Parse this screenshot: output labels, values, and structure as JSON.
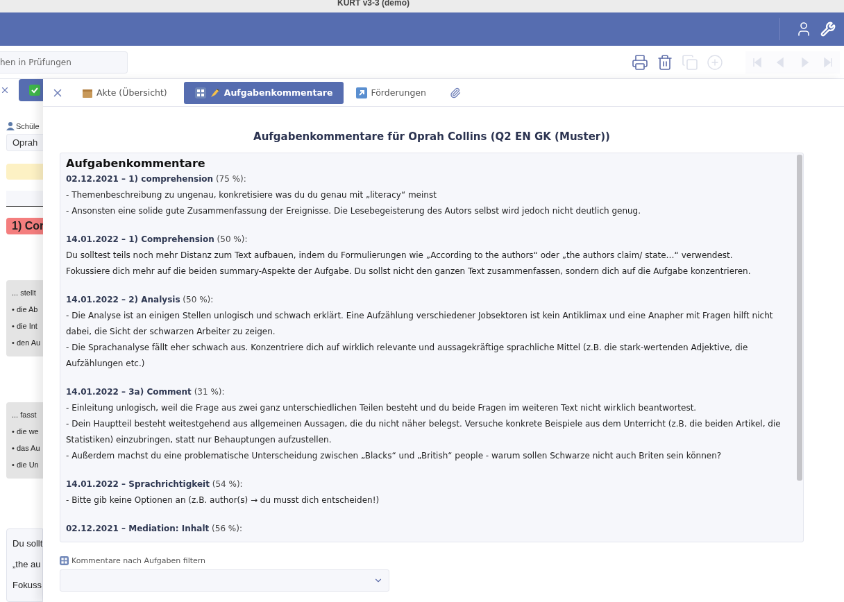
{
  "window": {
    "title": "KURT v3-3 (demo)"
  },
  "header": {
    "actions": [
      {
        "kind": "user"
      },
      {
        "kind": "settings"
      }
    ]
  },
  "toolbar": {
    "search": {
      "placeholder": "hen in Prüfungen"
    },
    "actions": [
      {
        "kind": "print",
        "disabled": false
      },
      {
        "kind": "delete",
        "disabled": false
      },
      {
        "kind": "copy",
        "disabled": true
      },
      {
        "kind": "add",
        "disabled": true
      }
    ],
    "navigation": [
      {
        "kind": "first",
        "disabled": true
      },
      {
        "kind": "previous",
        "disabled": true
      },
      {
        "kind": "next",
        "disabled": true
      },
      {
        "kind": "last",
        "disabled": true
      }
    ]
  },
  "background": {
    "tabs": [
      {
        "kind": "close",
        "selected": false
      },
      {
        "kind": "check",
        "selected": true
      }
    ],
    "student_label": "Schüle",
    "student_value": "Oprah",
    "heading": "1) Cor",
    "boxes": [
      {
        "kind": "grey",
        "lines": [
          "... stellt",
          "• die Ab",
          "• die Int",
          "• den Au"
        ]
      },
      {
        "kind": "grey",
        "lines": [
          "... fasst",
          "• die we",
          "• das Au",
          "• die Un"
        ]
      },
      {
        "kind": "light",
        "lines": [
          "Du sollt",
          "„the au",
          "Fokuss"
        ]
      }
    ]
  },
  "panel": {
    "tabs": [
      {
        "kind": "close",
        "selected": false
      },
      {
        "kind": "file",
        "label": "Akte (Übersicht)",
        "selected": false
      },
      {
        "kind": "comments",
        "label": "Aufgabenkommentare",
        "selected": true
      },
      {
        "kind": "support",
        "label": "Förderungen",
        "selected": false
      },
      {
        "kind": "attachment",
        "selected": false
      }
    ],
    "title": "Aufgabenkommentare für Oprah Collins (Q2 EN GK (Muster))",
    "comments": {
      "heading": "Aufgabenkommentare",
      "entries": [
        {
          "title": "**02.12.2021 – 1) comprehension** (75 %):",
          "lines": [
            "- Themenbeschreibung zu ungenau, konkretisiere was du du genau mit „literacy“ meinst",
            "- Ansonsten eine solide gute Zusammenfassung der Ereignisse. Die Lesebegeisterung des Autors selbst wird jedoch nicht deutlich genug."
          ]
        },
        {
          "title": "**14.01.2022 – 1) Comprehension** (50 %):",
          "lines": [
            "Du solltest teils noch mehr Distanz zum Text aufbauen, indem du Formulierungen wie „According to the authors“ oder „the authors claim/ state…“ verwendest.",
            "Fokussiere dich mehr auf die beiden summary-Aspekte der Aufgabe. Du sollst nicht den ganzen Text zusammenfassen, sondern dich auf die Aufgabe konzentrieren."
          ]
        },
        {
          "title": "**14.01.2022 – 2) Analysis** (50 %):",
          "lines": [
            "- Die Analyse ist an einigen Stellen unlogisch und schwach erklärt. Eine Aufzählung verschiedener Jobsektoren ist kein Antiklimax und eine Anapher mit Fragen hilft nicht dabei, die Sicht der schwarzen Arbeiter zu zeigen.",
            "- Die Sprachanalyse fällt eher schwach aus. Konzentriere dich auf wirklich relevante und aussagekräftige sprachliche Mittel (z.B. die stark-wertenden Adjektive, die Aufzählungen etc.)"
          ]
        },
        {
          "title": "**14.01.2022 – 3a) Comment** (31 %):",
          "lines": [
            "- Einleitung unlogisch, weil die Frage aus zwei ganz unterschiedlichen Teilen besteht und du beide Fragen im weiteren Text nicht wirklich beantwortest.",
            "- Dein Hauptteil besteht weitestgehend aus allgemeinen Aussagen, die du nicht näher belegst. Versuche konkrete Beispiele aus dem Unterricht (z.B. die beiden Artikel, die Statistiken) einzubringen, statt nur Behauptungen aufzustellen.",
            "- Außerdem machst du eine problematische Unterscheidung zwischen „Blacks“ und „British“ people - warum sollen Schwarze nicht auch Briten sein können?"
          ]
        },
        {
          "title": "**14.01.2022 – Sprachrichtigkeit** (54 %):",
          "lines": [
            "- Bitte gib keine Optionen an (z.B. author(s) → du musst dich entscheiden!)"
          ]
        },
        {
          "title": "**02.12.2021 – Mediation: Inhalt** (56 %):"
        }
      ]
    },
    "filter": {
      "label": "Kommentare nach Aufgaben filtern"
    }
  }
}
